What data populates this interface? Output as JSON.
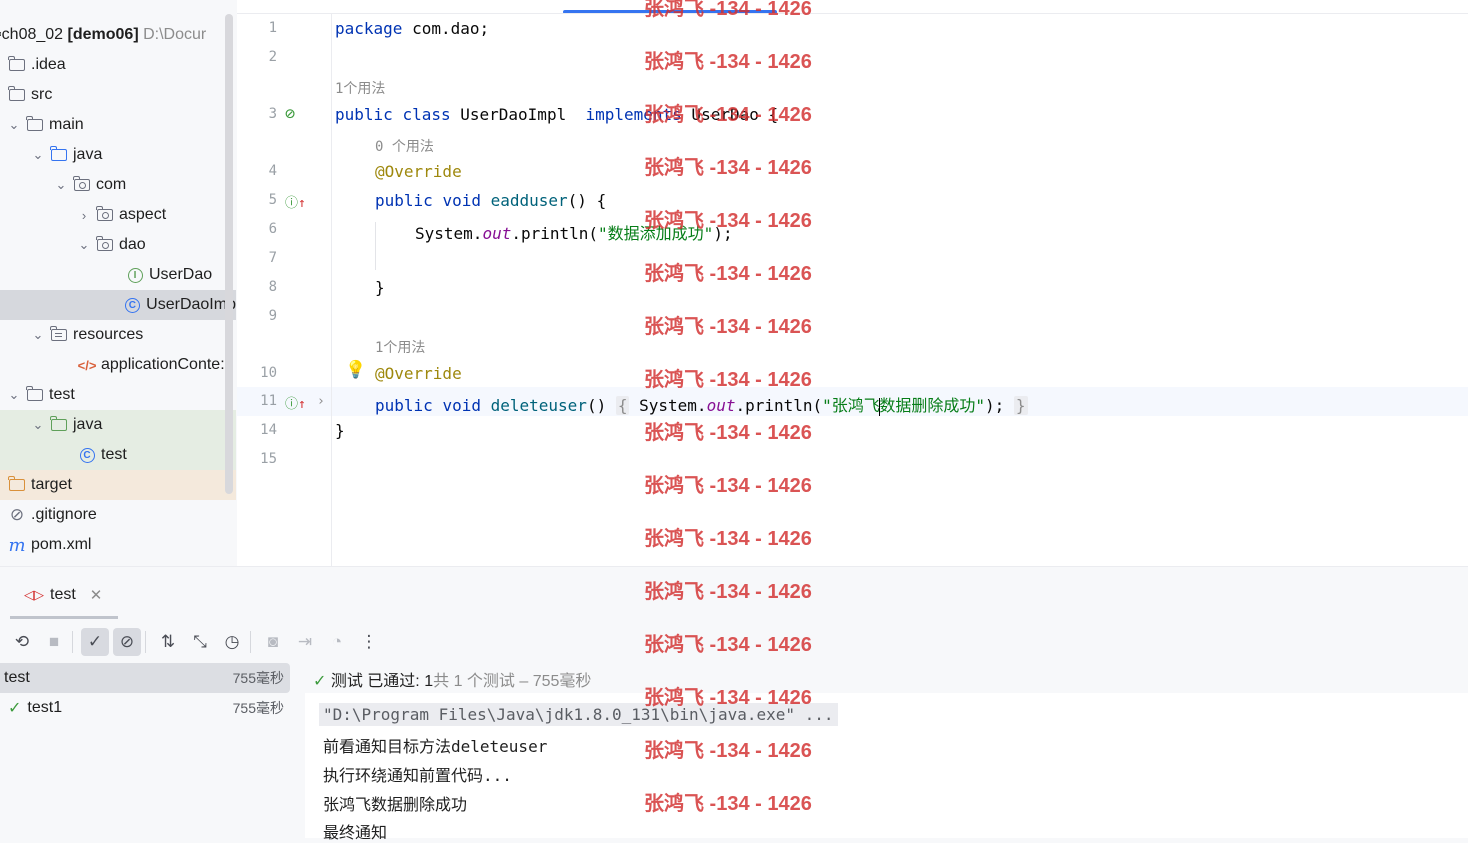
{
  "project": {
    "root_name": "ch08_02",
    "root_module": "[demo06]",
    "root_path": "D:\\Docur",
    "items": [
      {
        "label": ".idea"
      },
      {
        "label": "src"
      },
      {
        "label": "main"
      },
      {
        "label": "java"
      },
      {
        "label": "com"
      },
      {
        "label": "aspect"
      },
      {
        "label": "dao"
      },
      {
        "label": "UserDao"
      },
      {
        "label": "UserDaoImp"
      },
      {
        "label": "resources"
      },
      {
        "label": "applicationConte:"
      },
      {
        "label": "test"
      },
      {
        "label": "java"
      },
      {
        "label": "test"
      },
      {
        "label": "target"
      },
      {
        "label": ".gitignore"
      },
      {
        "label": "pom.xml"
      }
    ]
  },
  "editor": {
    "line_numbers": [
      "1",
      "2",
      "3",
      "4",
      "5",
      "6",
      "7",
      "8",
      "9",
      "10",
      "11",
      "14",
      "15"
    ],
    "hint_1": "1个用法",
    "hint_0": "0 个用法",
    "hint_1b": "1个用法",
    "l1_kw": "package",
    "l1_rest": " com.dao;",
    "l3_kw1": "public",
    "l3_kw2": "class",
    "l3_name": " UserDaoImpl  ",
    "l3_kw3": "implements",
    "l3_rest": " UserDao {",
    "override": "@Override",
    "l5_kw1": "public",
    "l5_kw2": "void",
    "l5_fn": "eadduser",
    "l5_rest": "() {",
    "l6_a": "System.",
    "l6_out": "out",
    "l6_b": ".println(",
    "l6_str": "\"数据添加成功\"",
    "l6_c": ");",
    "l8": "}",
    "l11_kw1": "public",
    "l11_kw2": "void",
    "l11_fn": "deleteuser",
    "l11_paren": "()",
    "l11_open": "{",
    "l11_a": "System.",
    "l11_out": "out",
    "l11_b": ".println(",
    "l11_str1": "\"张鸿飞",
    "l11_str2": "数据删除成功\"",
    "l11_c": ");",
    "l11_close": "}",
    "l14": "}"
  },
  "run": {
    "tab_label": "test",
    "status_prefix": "测试 已通过:",
    "status_count": "1",
    "status_rest": "共 1 个测试 – 755毫秒",
    "tests": [
      {
        "name": "test",
        "time": "755毫秒"
      },
      {
        "name": "test1",
        "time": "755毫秒"
      }
    ],
    "console": [
      "\"D:\\Program Files\\Java\\jdk1.8.0_131\\bin\\java.exe\" ...",
      "前看通知目标方法deleteuser",
      "执行环绕通知前置代码...",
      "张鸿飞数据删除成功",
      "最终通知"
    ]
  },
  "watermark": "张鸿飞 -134 - 1426",
  "colors": {
    "accent": "#3574f0",
    "watermark": "#d32f2f",
    "pass": "#3d9b3d"
  }
}
